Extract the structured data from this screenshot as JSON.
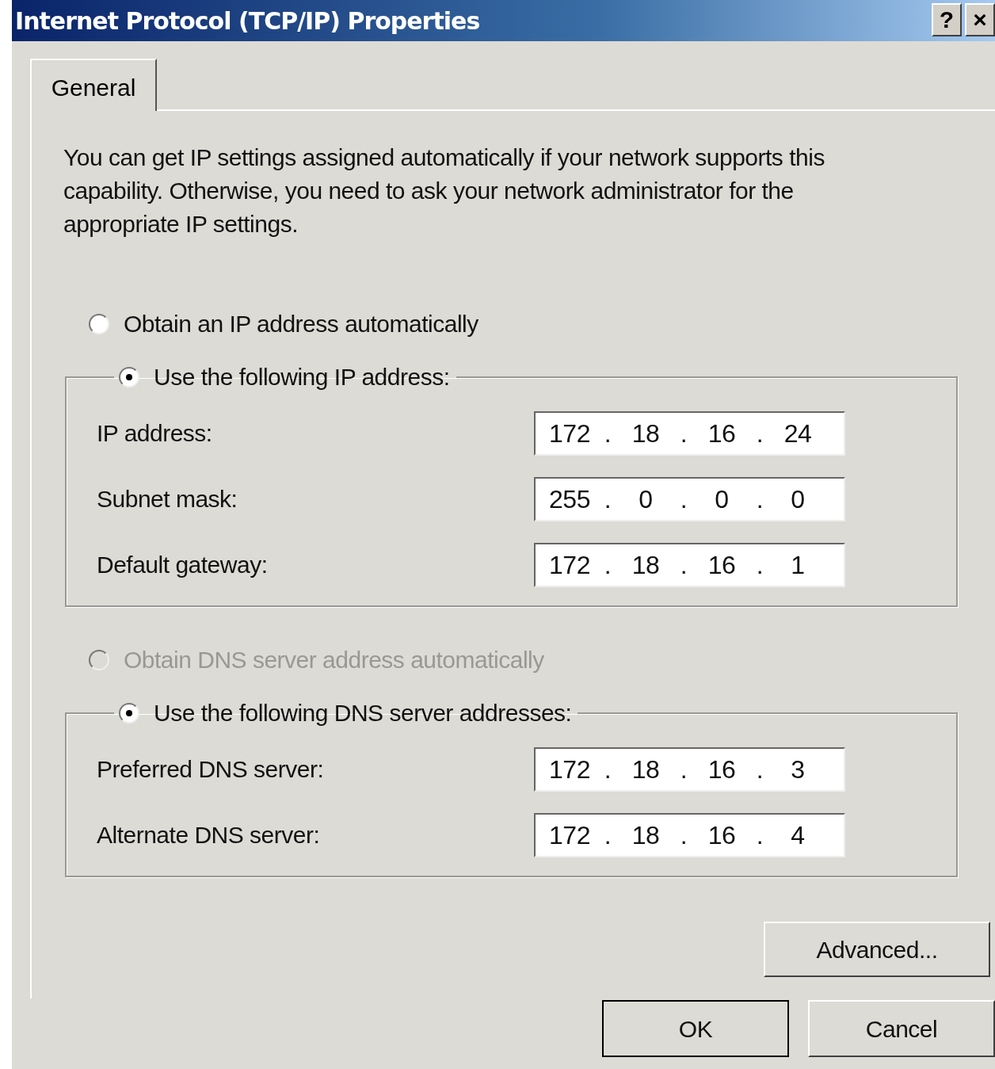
{
  "window": {
    "title": "Internet Protocol (TCP/IP) Properties",
    "buttons": [
      "?",
      "×"
    ]
  },
  "tabs": [
    {
      "label": "General",
      "selected": true
    }
  ],
  "description": "You can get IP settings assigned automatically if your network supports this capability. Otherwise, you need to ask your network administrator for the appropriate IP settings.",
  "ip_mode": [
    {
      "label": "Obtain an IP address automatically",
      "selected": false,
      "disabled": false
    },
    {
      "label": "Use the following IP address:",
      "selected": true,
      "disabled": false
    }
  ],
  "ip_fields": [
    {
      "label": "IP address:",
      "parts": [
        "172",
        ".",
        "18",
        ".",
        "16",
        ".",
        "24"
      ]
    },
    {
      "label": "Subnet mask:",
      "parts": [
        "255",
        ".",
        "0",
        ".",
        "0",
        ".",
        "0"
      ]
    },
    {
      "label": "Default gateway:",
      "parts": [
        "172",
        ".",
        "18",
        ".",
        "16",
        ".",
        "1"
      ]
    }
  ],
  "dns_mode": [
    {
      "label": "Obtain DNS server address automatically",
      "selected": false,
      "disabled": true
    },
    {
      "label": "Use the following DNS server addresses:",
      "selected": true,
      "disabled": false
    }
  ],
  "dns_fields": [
    {
      "label": "Preferred DNS server:",
      "parts": [
        "172",
        ".",
        "18",
        ".",
        "16",
        ".",
        "3"
      ]
    },
    {
      "label": "Alternate DNS server:",
      "parts": [
        "172",
        ".",
        "18",
        ".",
        "16",
        ".",
        "4"
      ]
    }
  ],
  "advanced_button": "Advanced...",
  "buttons": [
    "OK",
    "Cancel"
  ]
}
